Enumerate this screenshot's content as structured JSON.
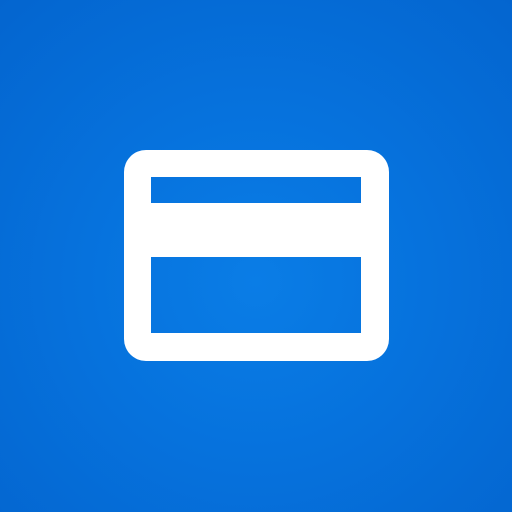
{
  "app_tile": {
    "icon": "credit-card-icon",
    "background_color": "#0672dd",
    "icon_color": "#ffffff"
  }
}
